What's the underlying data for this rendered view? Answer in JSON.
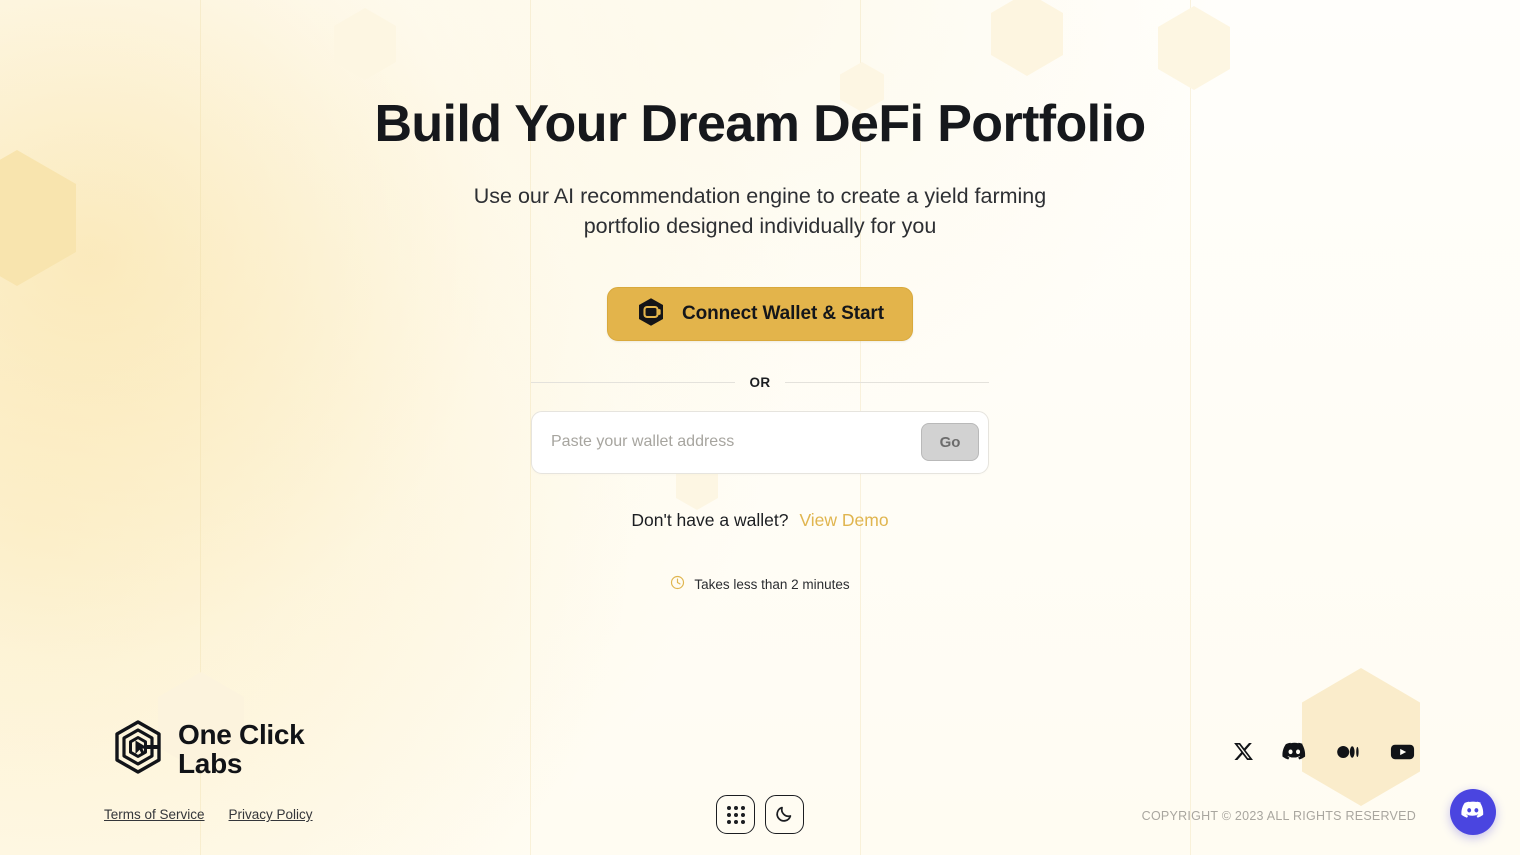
{
  "theme": {
    "accent": "#e3b44b",
    "accent_link": "#e0b54f",
    "text": "#16181c",
    "bg": "#fffdf7",
    "discord_blurple": "#4a45e0",
    "go_disabled_bg": "#d2d2d2"
  },
  "hero": {
    "headline": "Build Your Dream DeFi Portfolio",
    "subhead": "Use our AI recommendation engine to create a yield farming portfolio designed individually for you"
  },
  "cta": {
    "label": "Connect Wallet & Start",
    "icon": "wallet-hexagon-icon"
  },
  "divider": {
    "label": "OR"
  },
  "wallet_form": {
    "placeholder": "Paste your wallet address",
    "value": "",
    "submit_label": "Go",
    "submit_disabled": true
  },
  "demo": {
    "question": "Don't have a wallet?",
    "link_label": "View Demo"
  },
  "timing": {
    "icon": "clock-icon",
    "text": "Takes less than 2 minutes"
  },
  "footer": {
    "logo": {
      "icon": "one-click-labs-hexagon-cursor-logo",
      "line1": "One Click",
      "line2": "Labs"
    },
    "legal_links": [
      {
        "label": "Terms of Service"
      },
      {
        "label": "Privacy Policy"
      }
    ],
    "copyright": "COPYRIGHT © 2023 ALL RIGHTS RESERVED",
    "socials": [
      {
        "name": "x-twitter-icon",
        "label": "X"
      },
      {
        "name": "discord-icon",
        "label": "Discord"
      },
      {
        "name": "medium-icon",
        "label": "Medium"
      },
      {
        "name": "youtube-icon",
        "label": "YouTube"
      }
    ],
    "center_controls": [
      {
        "name": "apps-grid-icon",
        "label": "Apps"
      },
      {
        "name": "moon-icon",
        "label": "Dark mode"
      }
    ],
    "fab": {
      "name": "discord-floating-icon",
      "label": "Discord"
    }
  }
}
